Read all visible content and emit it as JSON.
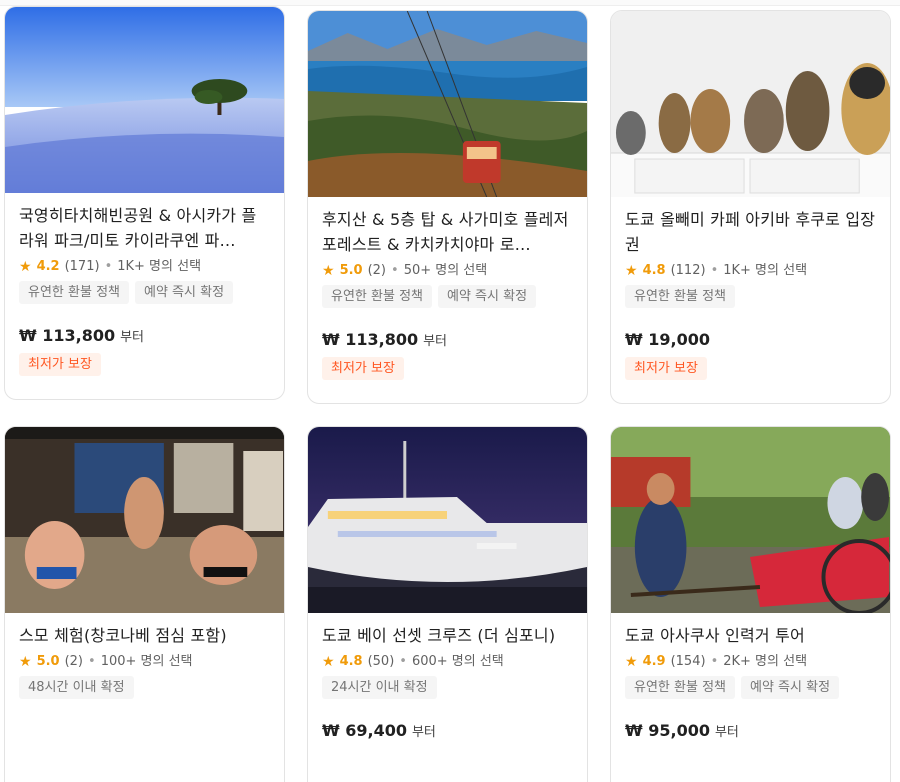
{
  "cards": [
    {
      "title": "국영히타치해빈공원 & 아시카가 플라워 파크/미토 카이라쿠엔 파…",
      "rating": "4.2",
      "reviews": "(171)",
      "popularity": "1K+ 명의 선택",
      "tags": [
        "유연한 환불 정책",
        "예약 즉시 확정"
      ],
      "price": "₩ 113,800",
      "price_suffix": "부터",
      "badge": "최저가 보장",
      "image": "flower-field-photo"
    },
    {
      "title": "후지산 & 5층 탑 & 사가미호 플레저 포레스트 & 카치카치야마 로…",
      "rating": "5.0",
      "reviews": "(2)",
      "popularity": "50+ 명의 선택",
      "tags": [
        "유연한 환불 정책",
        "예약 즉시 확정"
      ],
      "price": "₩ 113,800",
      "price_suffix": "부터",
      "badge": "최저가 보장",
      "image": "ropeway-lake-photo"
    },
    {
      "title": "도쿄 올빼미 카페 아키바 후쿠로 입장권",
      "rating": "4.8",
      "reviews": "(112)",
      "popularity": "1K+ 명의 선택",
      "tags": [
        "유연한 환불 정책"
      ],
      "price": "₩ 19,000",
      "price_suffix": "",
      "badge": "최저가 보장",
      "image": "owl-cafe-photo"
    },
    {
      "title": "스모 체험(창코나베 점심 포함)",
      "rating": "5.0",
      "reviews": "(2)",
      "popularity": "100+ 명의 선택",
      "tags": [
        "48시간 이내 확정"
      ],
      "price": "",
      "price_suffix": "",
      "badge": "",
      "image": "sumo-photo"
    },
    {
      "title": "도쿄 베이 선셋 크루즈 (더 심포니)",
      "rating": "4.8",
      "reviews": "(50)",
      "popularity": "600+ 명의 선택",
      "tags": [
        "24시간 이내 확정"
      ],
      "price": "₩ 69,400",
      "price_suffix": "부터",
      "badge": "",
      "image": "cruise-ship-photo"
    },
    {
      "title": "도쿄 아사쿠사 인력거 투어",
      "rating": "4.9",
      "reviews": "(154)",
      "popularity": "2K+ 명의 선택",
      "tags": [
        "유연한 환불 정책",
        "예약 즉시 확정"
      ],
      "price": "₩ 95,000",
      "price_suffix": "부터",
      "badge": "",
      "image": "rickshaw-photo"
    }
  ],
  "colors": {
    "star": "#f09b0a",
    "badge_text": "#ff5722",
    "badge_bg": "#fff1ea",
    "tag_bg": "#f5f5f5"
  }
}
